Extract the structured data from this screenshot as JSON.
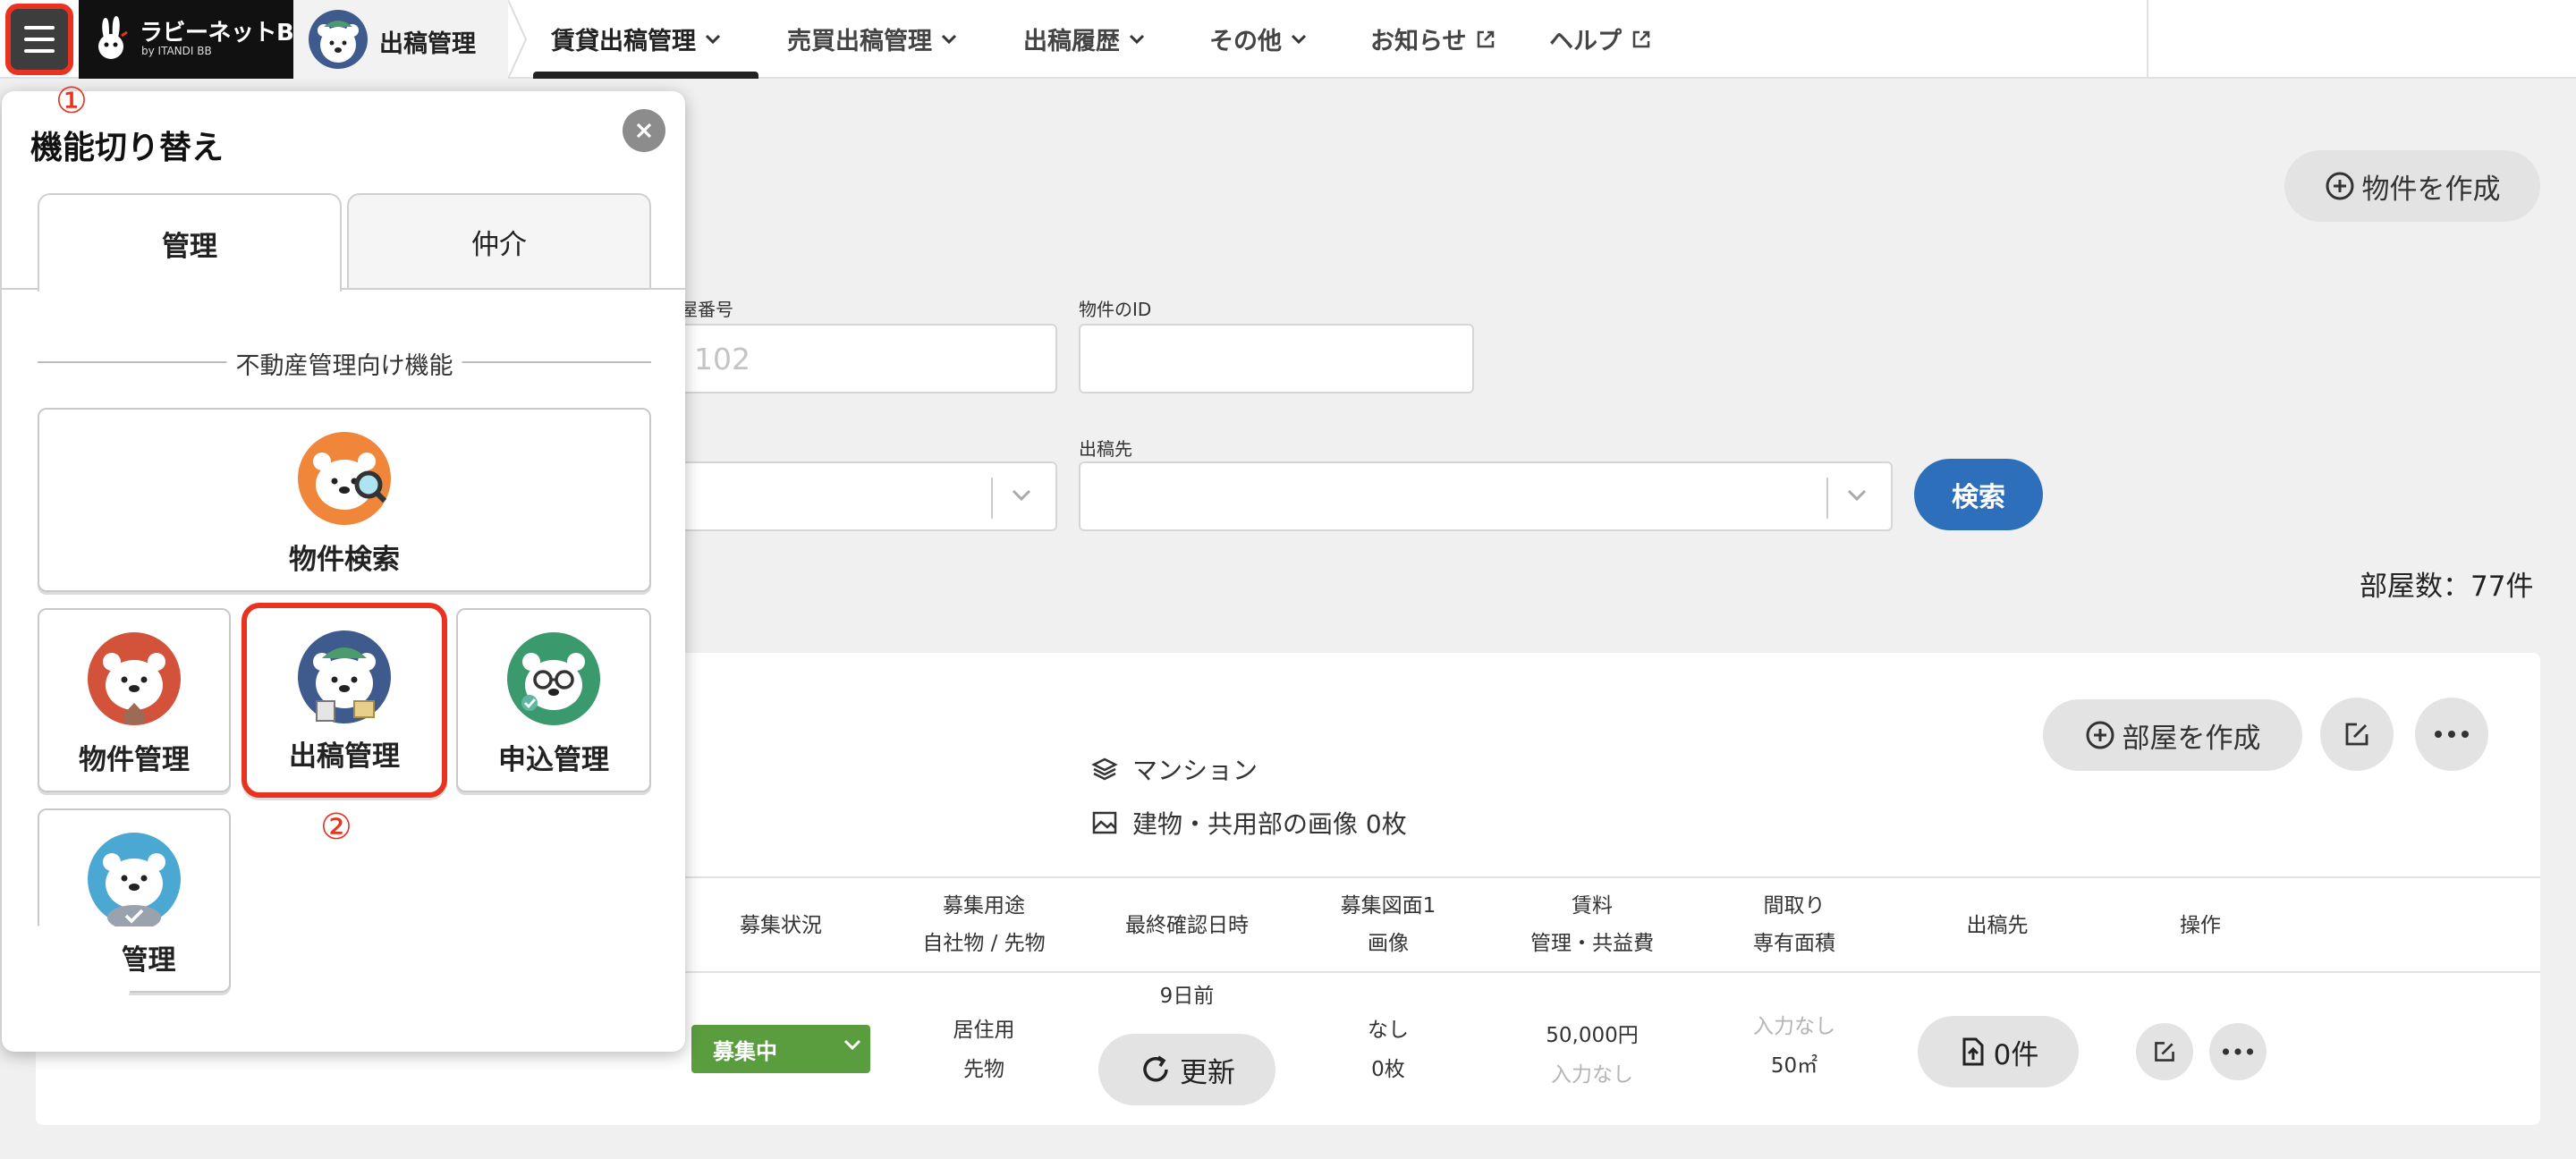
{
  "brand": {
    "logo_text": "ラビーネットBB",
    "logo_sub": "by ITANDI BB",
    "current_app": "出稿管理"
  },
  "nav": {
    "items": [
      {
        "label": "賃貸出稿管理",
        "active": true
      },
      {
        "label": "売買出稿管理"
      },
      {
        "label": "出稿履歴"
      },
      {
        "label": "その他"
      },
      {
        "label": "お知らせ"
      },
      {
        "label": "ヘルプ"
      }
    ]
  },
  "page": {
    "create_property": "物件を作成",
    "field_room_number_label": "部屋番号",
    "field_room_number_value": "102",
    "field_property_id_label": "物件のID",
    "field_destination_label": "出稿先",
    "search": "検索",
    "room_count": "部屋数：77件"
  },
  "card": {
    "create_room": "部屋を作成",
    "building_type": "マンション",
    "building_images": "建物・共用部の画像 0枚",
    "columns": [
      {
        "l1": "募集状況"
      },
      {
        "l1": "募集用途",
        "l2": "自社物 / 先物"
      },
      {
        "l1": "最終確認日時"
      },
      {
        "l1": "募集図面1",
        "l2": "画像"
      },
      {
        "l1": "賃料",
        "l2": "管理・共益費"
      },
      {
        "l1": "間取り",
        "l2": "専有面積"
      },
      {
        "l1": "出稿先"
      },
      {
        "l1": "操作"
      }
    ],
    "row": {
      "status": "募集中",
      "usage": "居住用",
      "ownership": "先物",
      "last_checked": "9日前",
      "renew": "更新",
      "drawing": "なし",
      "images": "0枚",
      "rent": "50,000円",
      "fee": "入力なし",
      "layout": "入力なし",
      "area": "50㎡",
      "publish": "0件"
    }
  },
  "switcher": {
    "title": "機能切り替え",
    "tabs": [
      {
        "label": "管理",
        "active": true
      },
      {
        "label": "仲介"
      }
    ],
    "section": "不動産管理向け機能",
    "functions": [
      {
        "label": "物件検索"
      },
      {
        "label": "物件管理"
      },
      {
        "label": "出稿管理",
        "selected": true
      },
      {
        "label": "申込管理"
      },
      {
        "label": "賃管理"
      }
    ],
    "markers": [
      "①",
      "②"
    ]
  },
  "colors": {
    "highlight": "#e9321f",
    "primary_blue": "#2d6fba",
    "status_green": "#5a9d3e",
    "logo_bg": "#111111"
  }
}
